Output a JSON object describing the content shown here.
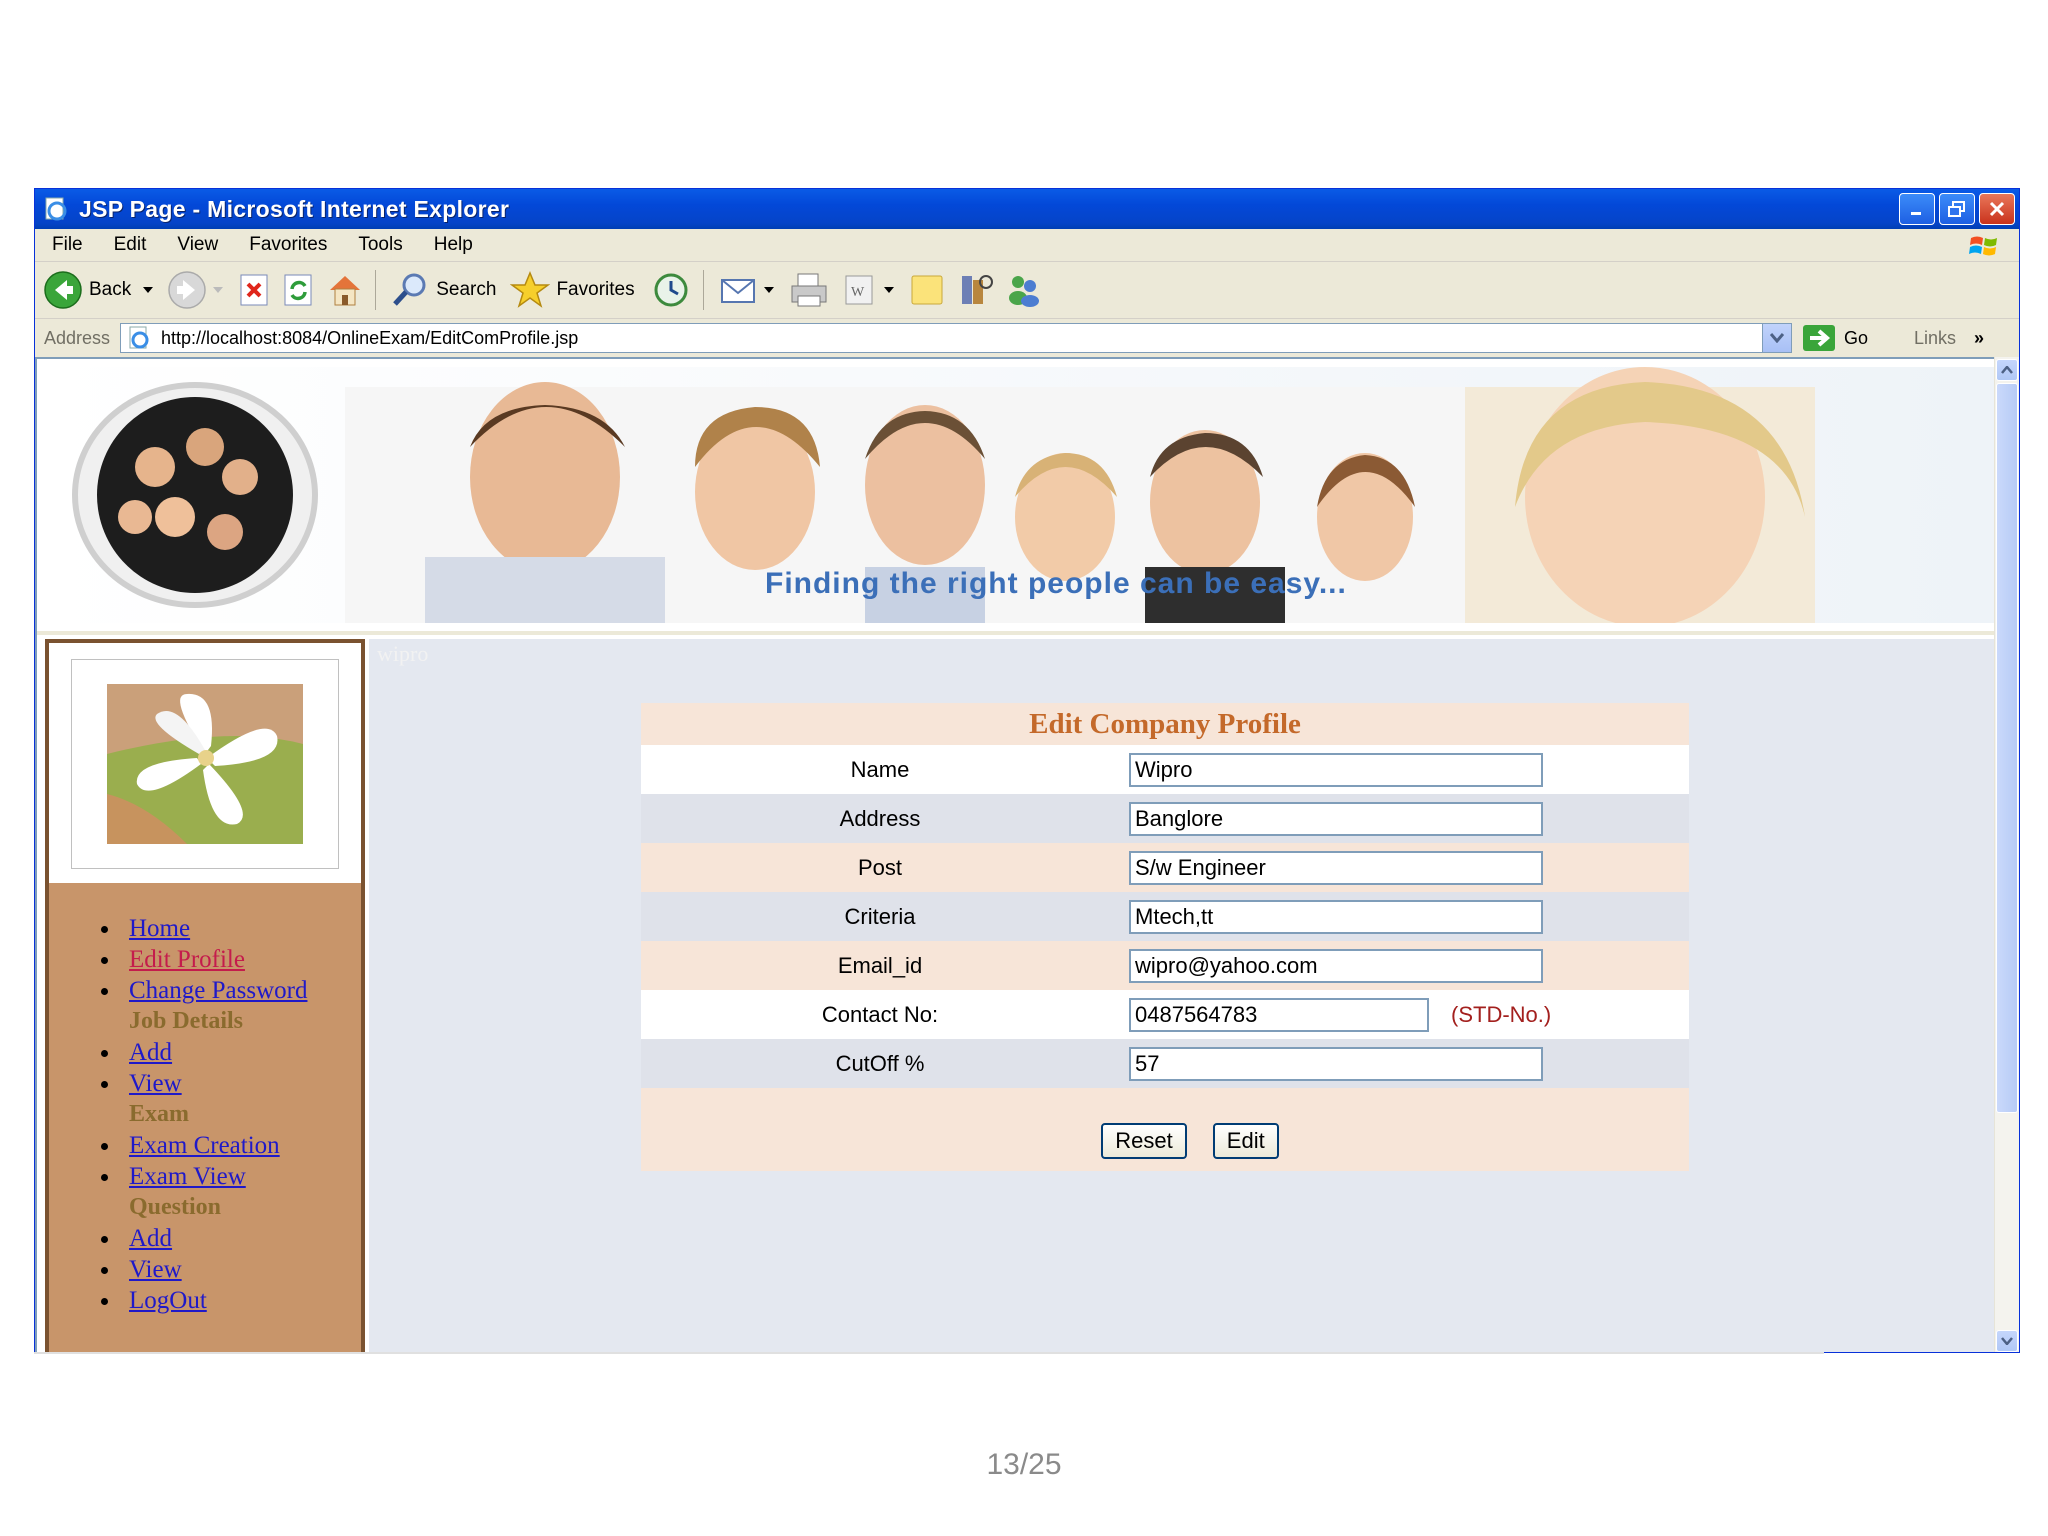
{
  "window": {
    "title": "JSP Page - Microsoft Internet Explorer"
  },
  "menu": [
    "File",
    "Edit",
    "View",
    "Favorites",
    "Tools",
    "Help"
  ],
  "toolbar": {
    "back_label": "Back",
    "search_label": "Search",
    "favorites_label": "Favorites"
  },
  "address_bar": {
    "label": "Address",
    "url": "http://localhost:8084/OnlineExam/EditComProfile.jsp",
    "go_label": "Go",
    "links_label": "Links"
  },
  "banner": {
    "tagline": "Finding the right people can be easy..."
  },
  "sidebar": {
    "nav": [
      {
        "type": "link",
        "label": "Home"
      },
      {
        "type": "link",
        "label": "Edit Profile",
        "active": true
      },
      {
        "type": "link",
        "label": "Change Password"
      },
      {
        "type": "header",
        "label": "Job Details"
      },
      {
        "type": "link",
        "label": "Add"
      },
      {
        "type": "link",
        "label": "View"
      },
      {
        "type": "header",
        "label": "Exam"
      },
      {
        "type": "link",
        "label": "Exam Creation"
      },
      {
        "type": "link",
        "label": "Exam View"
      },
      {
        "type": "header",
        "label": "Question"
      },
      {
        "type": "link",
        "label": "Add"
      },
      {
        "type": "link",
        "label": "View"
      },
      {
        "type": "link",
        "label": "LogOut"
      }
    ]
  },
  "main": {
    "ghost_text": "wipro"
  },
  "form": {
    "title": "Edit Company Profile",
    "fields": [
      {
        "label": "Name",
        "value": "Wipro"
      },
      {
        "label": "Address",
        "value": "Banglore"
      },
      {
        "label": "Post",
        "value": "S/w Engineer"
      },
      {
        "label": "Criteria",
        "value": "Mtech,tt"
      },
      {
        "label": "Email_id",
        "value": "wipro@yahoo.com"
      },
      {
        "label": "Contact No:",
        "value": "0487564783",
        "hint": "(STD-No.)"
      },
      {
        "label": "CutOff %",
        "value": "57"
      }
    ],
    "reset_label": "Reset",
    "edit_label": "Edit"
  },
  "slide": {
    "page_number": "13/25"
  },
  "colors": {
    "title_bar": "#0348d8",
    "sidebar_bg": "#c8956a",
    "form_bg": "#f7e5d8",
    "form_title": "#c4692a",
    "link": "#1f19c9",
    "active_link": "#c41c4c"
  }
}
